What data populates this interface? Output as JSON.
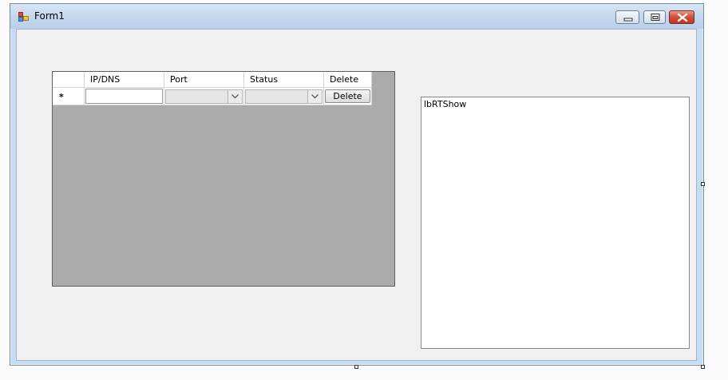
{
  "window": {
    "title": "Form1"
  },
  "icons": {
    "app": "form-icon",
    "minimize": "minimize-icon",
    "maximize": "maximize-icon",
    "close": "close-icon",
    "combo_arrow": "chevron-down-icon"
  },
  "grid": {
    "columns": [
      {
        "key": "row_header",
        "label": ""
      },
      {
        "key": "ip",
        "label": "IP/DNS"
      },
      {
        "key": "port",
        "label": "Port"
      },
      {
        "key": "status",
        "label": "Status"
      },
      {
        "key": "delete",
        "label": "Delete"
      }
    ],
    "new_row": {
      "marker": "*",
      "ip": "",
      "port": "",
      "status": "",
      "delete_label": "Delete"
    }
  },
  "listbox": {
    "name_text": "lbRTShow"
  },
  "colors": {
    "grid_background": "#ababab",
    "form_background": "#f0f0f0",
    "close_button": "#c2361f"
  }
}
